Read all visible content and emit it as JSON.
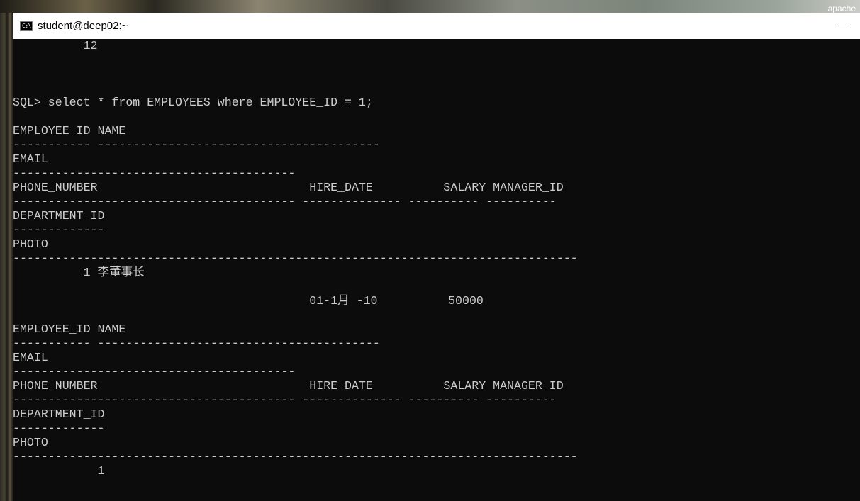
{
  "desktop": {
    "corner_label": "apache"
  },
  "window": {
    "title": "student@deep02:~",
    "icon": "cmd-icon",
    "icon_text": "C:\\."
  },
  "console": {
    "lines": [
      "          12",
      "",
      "",
      "",
      "SQL> select * from EMPLOYEES where EMPLOYEE_ID = 1;",
      "",
      "EMPLOYEE_ID NAME",
      "----------- ----------------------------------------",
      "EMAIL",
      "----------------------------------------",
      "PHONE_NUMBER                              HIRE_DATE          SALARY MANAGER_ID",
      "---------------------------------------- -------------- ---------- ----------",
      "DEPARTMENT_ID",
      "-------------",
      "PHOTO",
      "--------------------------------------------------------------------------------",
      "          1 李董事长",
      "",
      "                                          01-1月 -10          50000",
      "",
      "EMPLOYEE_ID NAME",
      "----------- ----------------------------------------",
      "EMAIL",
      "----------------------------------------",
      "PHONE_NUMBER                              HIRE_DATE          SALARY MANAGER_ID",
      "---------------------------------------- -------------- ---------- ----------",
      "DEPARTMENT_ID",
      "-------------",
      "PHOTO",
      "--------------------------------------------------------------------------------",
      "            1"
    ]
  }
}
